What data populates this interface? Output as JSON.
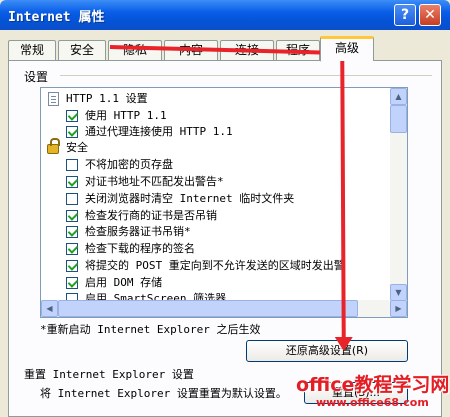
{
  "window": {
    "title": "Internet 属性",
    "help_label": "?",
    "close_label": "✕"
  },
  "tabs": [
    {
      "label": "常规"
    },
    {
      "label": "安全"
    },
    {
      "label": "隐私"
    },
    {
      "label": "内容"
    },
    {
      "label": "连接"
    },
    {
      "label": "程序"
    },
    {
      "label": "高级"
    }
  ],
  "settings": {
    "group_label": "设置",
    "items": [
      {
        "label": "HTTP 1.1 设置",
        "kind": "category",
        "icon": "page-icon"
      },
      {
        "label": "使用 HTTP 1.1",
        "kind": "checkbox",
        "checked": true
      },
      {
        "label": "通过代理连接使用 HTTP 1.1",
        "kind": "checkbox",
        "checked": true
      },
      {
        "label": "安全",
        "kind": "category",
        "icon": "lock-icon"
      },
      {
        "label": "不将加密的页存盘",
        "kind": "checkbox",
        "checked": false
      },
      {
        "label": "对证书地址不匹配发出警告*",
        "kind": "checkbox",
        "checked": true
      },
      {
        "label": "关闭浏览器时清空 Internet 临时文件夹",
        "kind": "checkbox",
        "checked": false
      },
      {
        "label": "检查发行商的证书是否吊销",
        "kind": "checkbox",
        "checked": true
      },
      {
        "label": "检查服务器证书吊销*",
        "kind": "checkbox",
        "checked": true
      },
      {
        "label": "检查下载的程序的签名",
        "kind": "checkbox",
        "checked": true
      },
      {
        "label": "将提交的 POST 重定向到不允许发送的区域时发出警",
        "kind": "checkbox",
        "checked": true
      },
      {
        "label": "启用 DOM 存储",
        "kind": "checkbox",
        "checked": true
      },
      {
        "label": "启用 SmartScreen 筛选器",
        "kind": "checkbox",
        "checked": false
      }
    ],
    "restart_note": "*重新启动 Internet Explorer 之后生效",
    "restore_button": "还原高级设置(R)"
  },
  "reset": {
    "title": "重置 Internet Explorer 设置",
    "description": "将 Internet Explorer 设置重置为默认设置。",
    "button": "重置(S)..."
  },
  "watermark": {
    "text": "office教程学习网",
    "url": "www.office68.com"
  }
}
